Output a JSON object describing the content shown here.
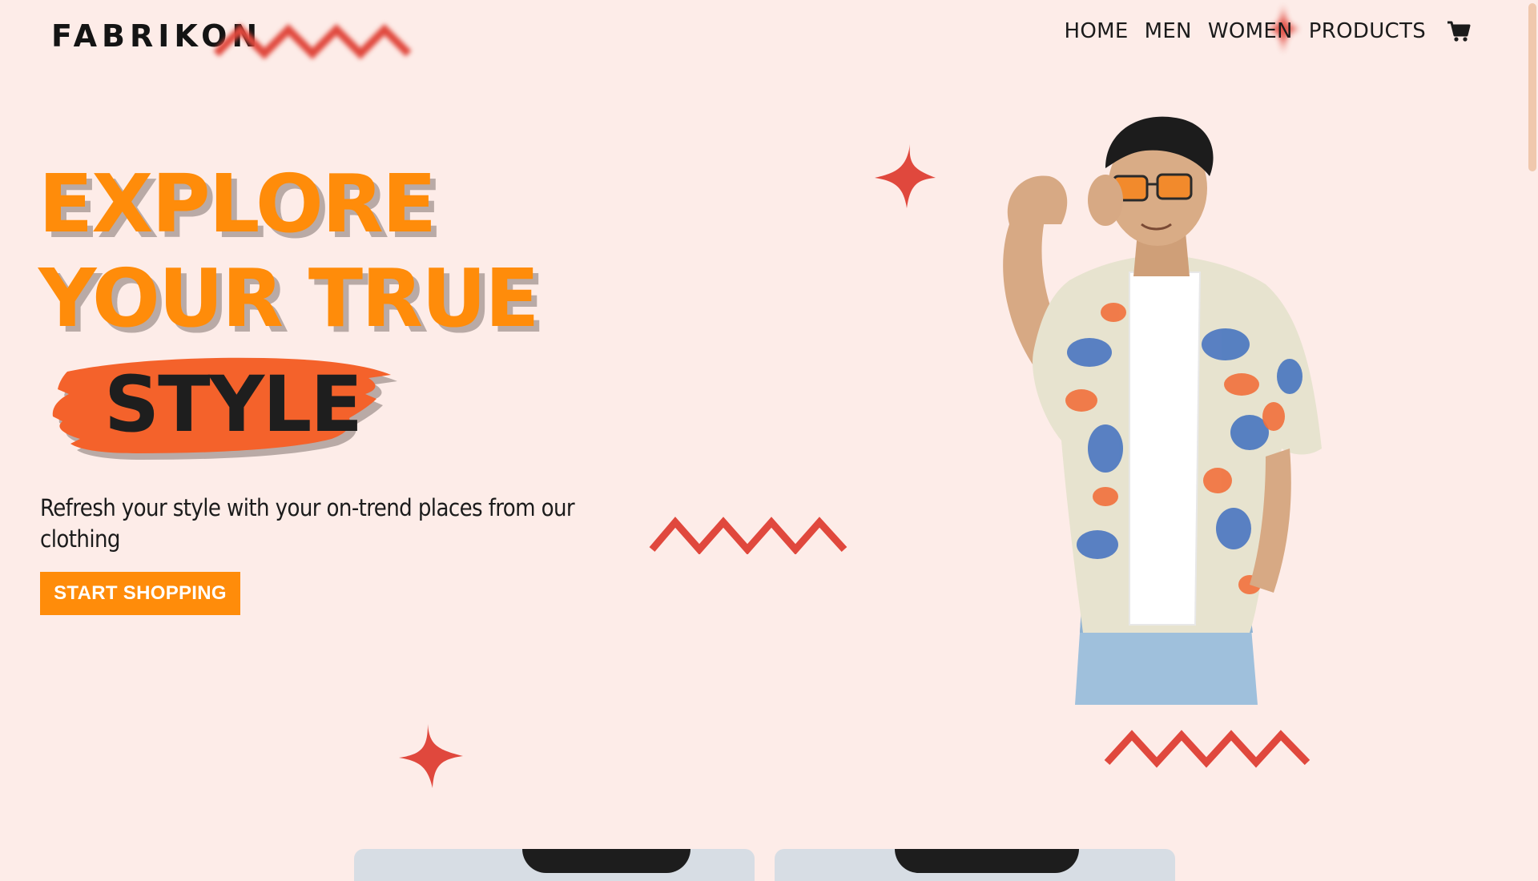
{
  "brand": {
    "name": "FABRIKON"
  },
  "nav": {
    "links": [
      "HOME",
      "MEN",
      "WOMEN",
      "PRODUCTS"
    ],
    "cart_icon": "cart-icon"
  },
  "hero": {
    "title_line1": "EXPLORE",
    "title_line2": "YOUR TRUE",
    "title_highlight": "STYLE",
    "subtitle": "Refresh your style with your on-trend places from our clothing",
    "cta_label": "START SHOPPING"
  },
  "colors": {
    "background": "#fdece8",
    "accent_orange": "#ff8c0a",
    "brush_orange": "#f4622b",
    "decor_red": "#e0483d",
    "text": "#1b1b1b"
  },
  "decor_icons": [
    "sparkle-icon",
    "zigzag-icon"
  ]
}
